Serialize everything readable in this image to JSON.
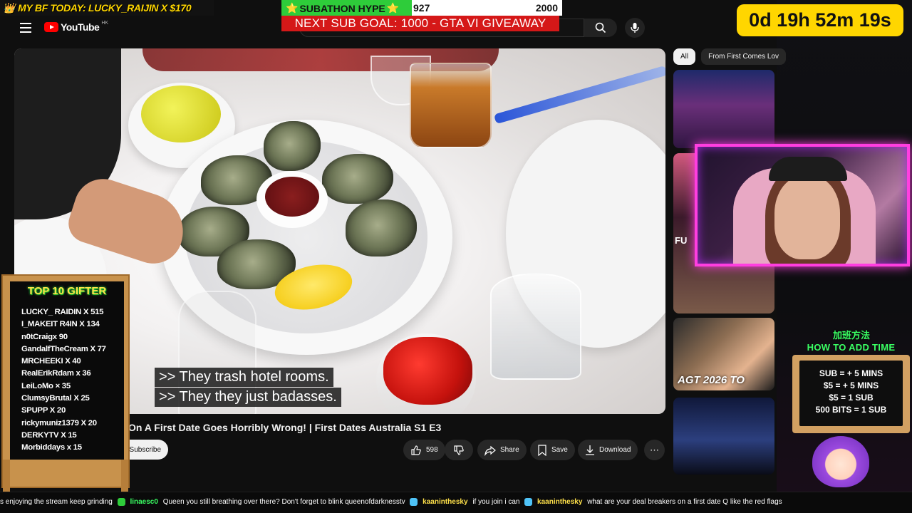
{
  "overlay": {
    "bf_banner": "MY BF TODAY: LUCKY_RAIJIN X $170",
    "subathon": {
      "label": "SUBATHON HYPE",
      "current": "927",
      "goal": "2000",
      "progress": 0.4635
    },
    "sub_goal": "NEXT SUB GOAL: 1000 - GTA VI GIVEAWAY",
    "timer": "0d 19h 52m 19s",
    "gifter_board": {
      "title": "TOP 10 GIFTER",
      "entries": [
        "LUCKY_ RAIDIN X 515",
        "I_MAKEIT R4IN X 134",
        "n0tCraigx 90",
        "GandalfTheCream X 77",
        "MRCHEEKI X 40",
        "RealErikRdam x 36",
        "LeiLoMo × 35",
        "ClumsyBrutal X 25",
        "SPUPP X 20",
        "rickymuniz1379 X 20",
        "DERKYTV X 15",
        "Morbiddays x 15"
      ]
    },
    "how_to": {
      "title_cn": "加班方法",
      "title": "HOW TO ADD TIME",
      "rules": [
        "SUB = + 5 MINS",
        "$5 = + 5 MINS",
        "$5 = 1 SUB",
        "500 BITS = 1 SUB"
      ]
    },
    "chat_ticker": [
      {
        "user": "",
        "text": "s enjoying the stream keep grinding"
      },
      {
        "user": "linaesc0",
        "text": "Queen you still breathing over there? Don't forget to blink queenofdarknesstv"
      },
      {
        "user": "kaaninthesky",
        "text": "if you join i can"
      },
      {
        "user": "kaaninthesky",
        "text": "what are your deal breakers on a first date Q like the red flags"
      }
    ]
  },
  "youtube": {
    "logo": "YouTube",
    "region": "HK",
    "captions": [
      ">> They trash hotel rooms.",
      ">> They they just badasses."
    ],
    "video_title": "On A First Date Goes Horribly Wrong! | First Dates Australia S1 E3",
    "subscribe": "Subscribe",
    "actions": {
      "like_count": "598",
      "share": "Share",
      "save": "Save",
      "download": "Download"
    },
    "chips": [
      "All",
      "From First Comes Lov"
    ],
    "thumbnails": {
      "third_label": "AGT 2026 TO",
      "side_text": "FU"
    }
  },
  "colors": {
    "timer_bg": "#ffd600",
    "sub_goal_bg": "#d51818",
    "hype_fill": "#2ecc3a",
    "webcam_border": "#ff3ee0",
    "how_to_green": "#3aff63"
  }
}
